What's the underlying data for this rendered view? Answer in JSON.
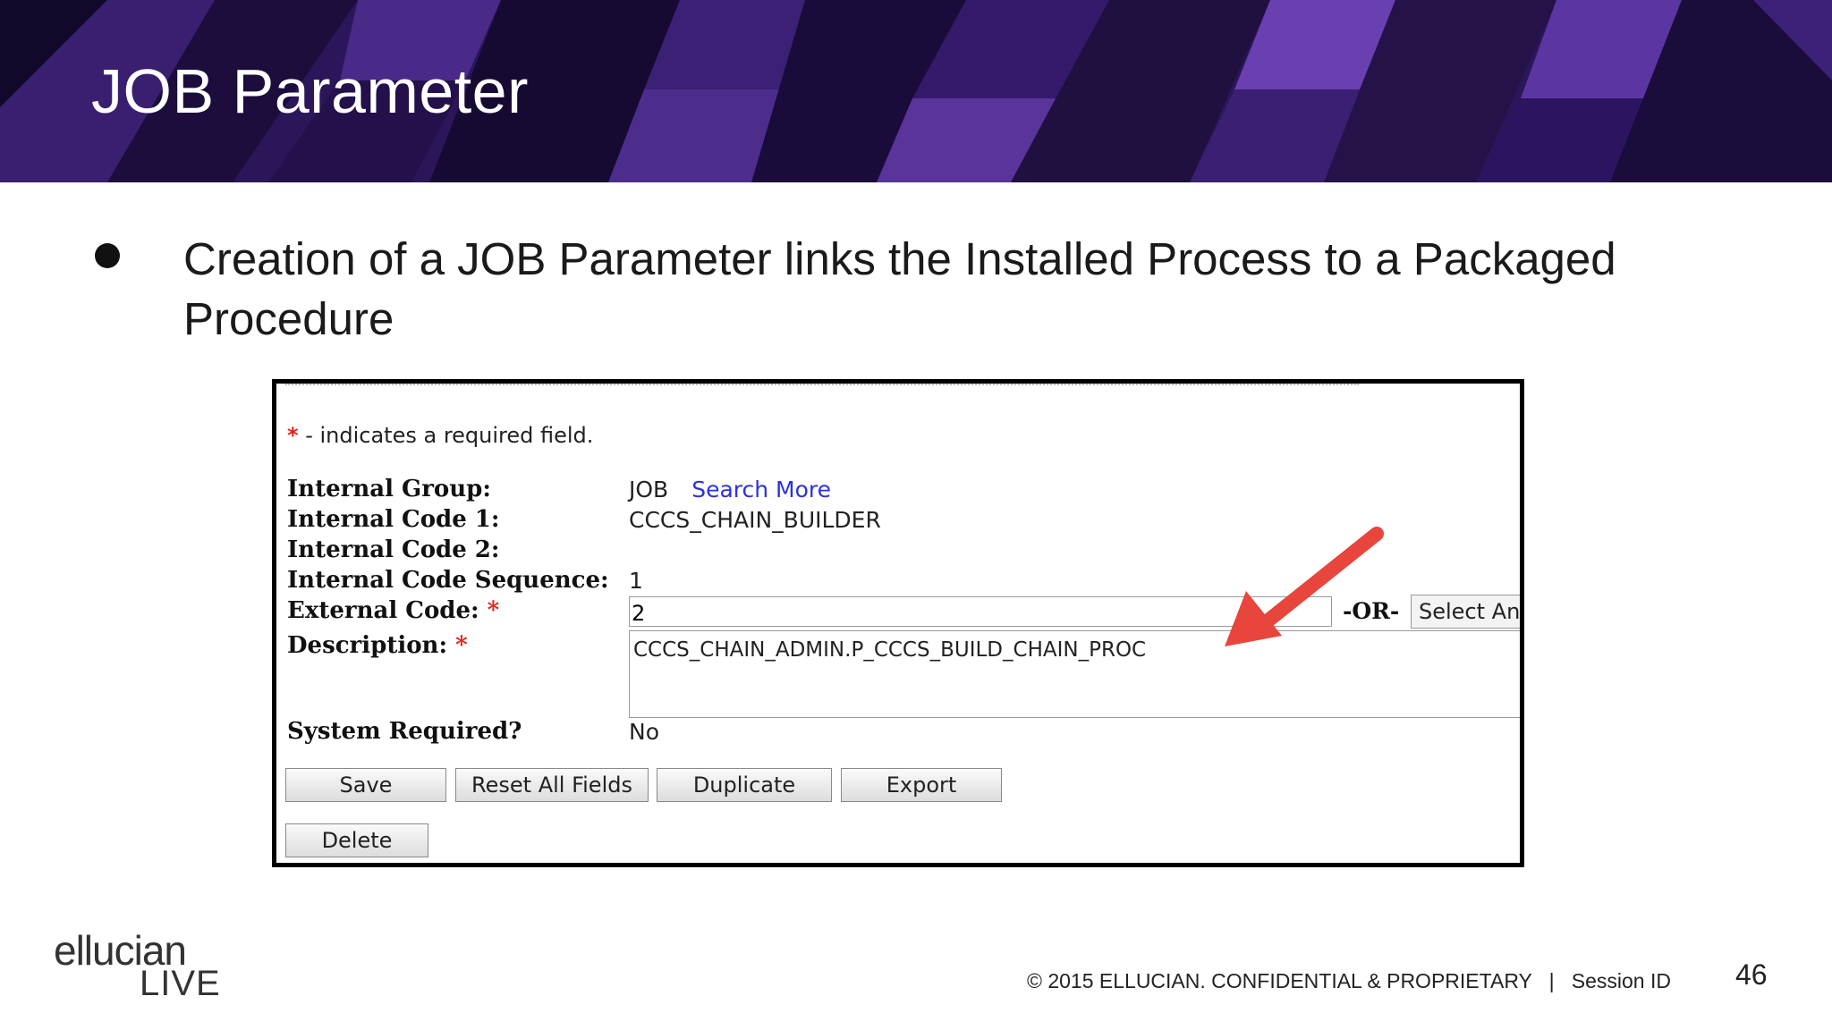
{
  "slide": {
    "title": "JOB Parameter",
    "bullet": "Creation of a JOB Parameter links the Installed Process to a Packaged Procedure"
  },
  "screenshot": {
    "required_note": "- indicates a required field.",
    "required_star": "*",
    "fields": {
      "internal_group_label": "Internal Group:",
      "internal_group_value": "JOB",
      "search_more_link": "Search More",
      "internal_code1_label": "Internal Code 1:",
      "internal_code1_value": "CCCS_CHAIN_BUILDER",
      "internal_code2_label": "Internal Code 2:",
      "internal_code2_value": "",
      "internal_code_seq_label": "Internal Code Sequence:",
      "internal_code_seq_value": "1",
      "external_code_label": "External Code:",
      "external_code_value": "2",
      "or_text": "-OR-",
      "select_button": "Select An",
      "description_label": "Description:",
      "description_value": "CCCS_CHAIN_ADMIN.P_CCCS_BUILD_CHAIN_PROC",
      "system_required_label": "System Required?",
      "system_required_value": "No"
    },
    "buttons": {
      "save": "Save",
      "reset": "Reset All Fields",
      "duplicate": "Duplicate",
      "export": "Export",
      "delete": "Delete"
    }
  },
  "footer": {
    "logo_top": "ellucian",
    "logo_bottom": "LIVE",
    "copyright": "© 2015 ELLUCIAN. CONFIDENTIAL & PROPRIETARY   |   Session ID",
    "page_number": "46"
  },
  "colors": {
    "banner": "#2a1558",
    "arrow": "#e8453c",
    "link": "#2b32e0",
    "required": "#e0221b"
  }
}
